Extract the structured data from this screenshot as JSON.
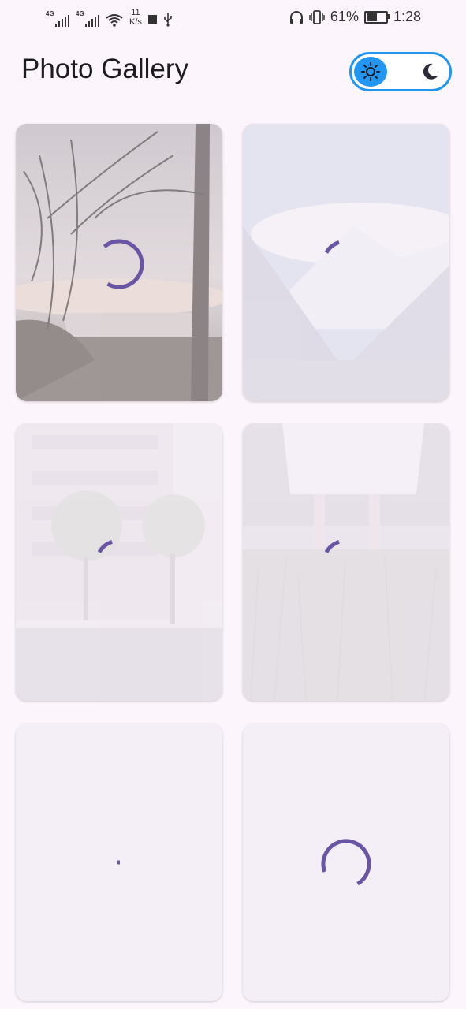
{
  "status_bar": {
    "network_1": "4G",
    "network_2": "4G",
    "speed_value": "11",
    "speed_unit": "K/s",
    "battery_percent": "61%",
    "battery_level": 0.61,
    "time": "1:28"
  },
  "header": {
    "title": "Photo Gallery",
    "theme_toggle": {
      "selected": "light",
      "light_icon": "sun-icon",
      "dark_icon": "moon-icon"
    }
  },
  "colors": {
    "accent": "#2196f3",
    "spinner": "#6a55a5",
    "background": "#fcf5fc",
    "card_placeholder": "#f4eef6"
  },
  "gallery": {
    "items": [
      {
        "subject": "misty lake with trees",
        "opacity": 0.62,
        "loading": true
      },
      {
        "subject": "snowy mountain valley",
        "opacity": 0.18,
        "loading": true
      },
      {
        "subject": "street with trees and building",
        "opacity": 0.12,
        "loading": true
      },
      {
        "subject": "person standing in tall grass",
        "opacity": 0.1,
        "loading": true
      },
      {
        "subject": "",
        "opacity": 0,
        "loading": true
      },
      {
        "subject": "",
        "opacity": 0,
        "loading": true
      }
    ]
  }
}
